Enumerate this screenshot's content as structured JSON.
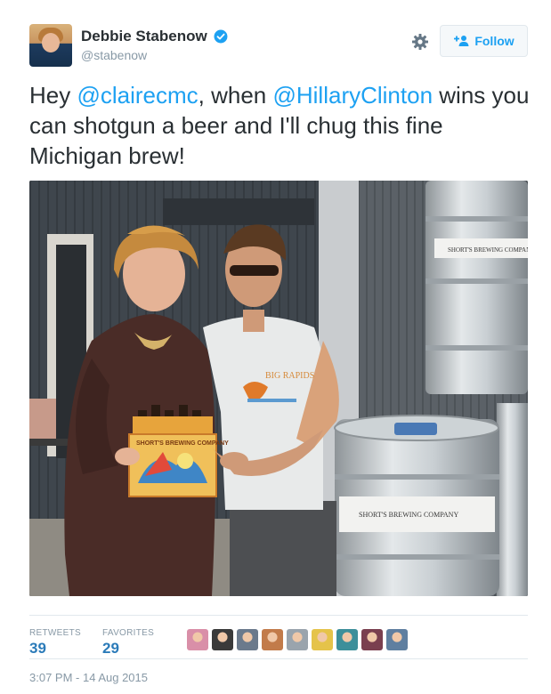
{
  "user": {
    "display_name": "Debbie Stabenow",
    "handle": "@stabenow",
    "verified_icon": "verified-badge-icon"
  },
  "actions": {
    "follow_label": "Follow",
    "settings_icon": "gear-icon"
  },
  "tweet": {
    "part1": "Hey ",
    "mention1": "@clairecmc",
    "part2": ", when ",
    "mention2": "@HillaryClinton",
    "part3": " wins you can shotgun a beer and I'll chug this fine Michigan brew!"
  },
  "photo": {
    "keg_text": "SHORT'S BREWING COMPANY",
    "keg_text_2": "SHORT'S BREWING COMPANY",
    "box_text": "SHORT'S BREWING COMPANY",
    "shirt_text": "BIG RAPIDS"
  },
  "stats": {
    "retweets_label": "RETWEETS",
    "retweets_value": "39",
    "favorites_label": "FAVORITES",
    "favorites_value": "29"
  },
  "favoriter_colors": [
    "#d98fa8",
    "#3a3a3a",
    "#6b7a8c",
    "#c27b4a",
    "#9aa4ad",
    "#e5c34a",
    "#3d8f9a",
    "#7a3f4f",
    "#5f7fa0"
  ],
  "timestamp": "3:07 PM - 14 Aug 2015",
  "colors": {
    "accent": "#1da1f2",
    "link": "#2b7bb9",
    "muted": "#8899a6",
    "text": "#292f33"
  }
}
